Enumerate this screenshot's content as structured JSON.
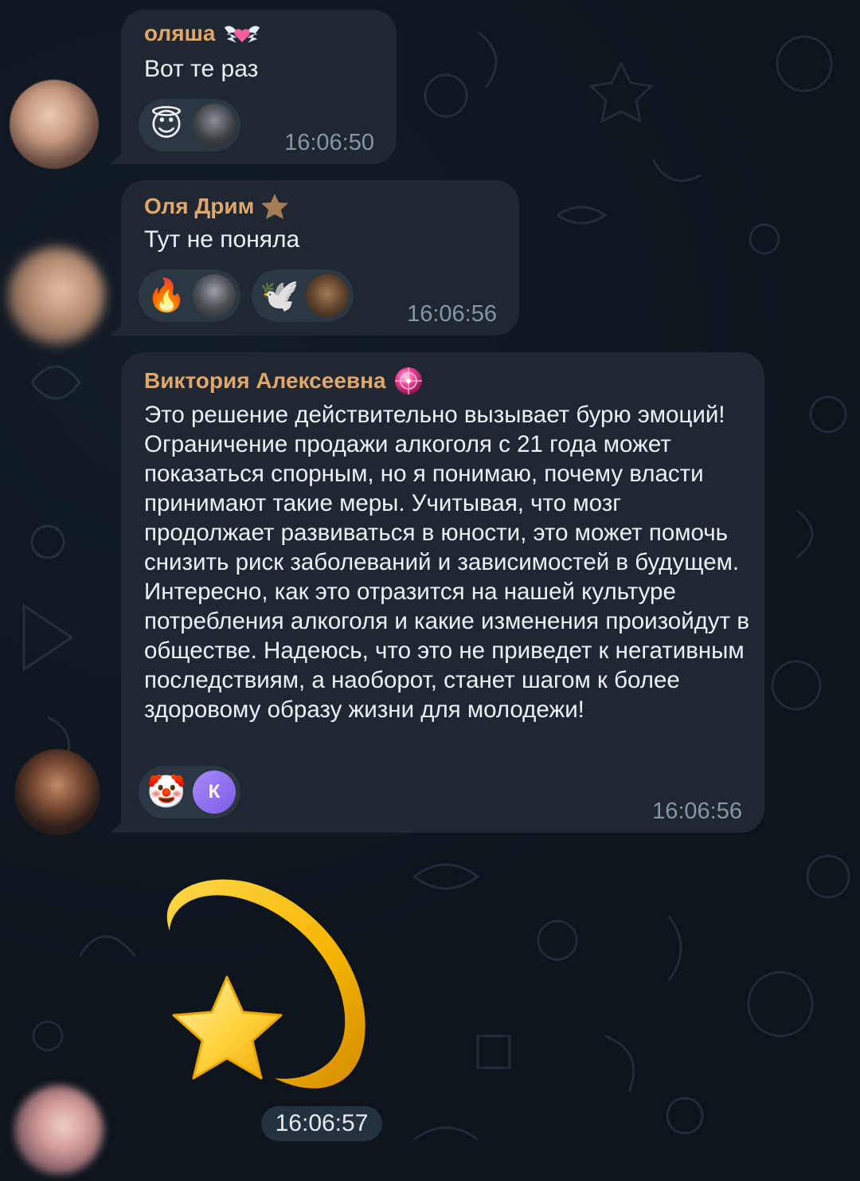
{
  "messages": [
    {
      "sender": "оляша",
      "badge_icon": "winged-heart-icon",
      "text": "Вот те раз",
      "time": "16:06:50",
      "reactions": [
        {
          "emoji": "😇",
          "emoji_name": "smiling-face-with-halo-icon"
        }
      ]
    },
    {
      "sender": "Оля Дрим",
      "badge_icon": "star-icon",
      "text": "Тут не поняла",
      "time": "16:06:56",
      "reactions": [
        {
          "emoji": "🔥",
          "emoji_name": "fire-icon"
        },
        {
          "emoji": "🕊️",
          "emoji_name": "dove-icon"
        }
      ]
    },
    {
      "sender": "Виктория Алексеевна",
      "badge_icon": "pink-orb-icon",
      "text": "Это решение действительно вызывает бурю эмоций! Ограничение продажи алкоголя с 21 года может показаться спорным, но я понимаю, почему власти принимают такие меры. Учитывая, что мозг продолжает развиваться в юности, это может помочь снизить риск заболеваний и зависимостей в будущем. Интересно, как это отразится на нашей культуре потребления алкоголя и какие изменения произойдут в обществе. Надеюсь, что это не приведет к негативным последствиям, а наоборот, станет шагом к более здоровому образу жизни для молодежи!",
      "time": "16:06:56",
      "reactions": [
        {
          "emoji": "🤡",
          "emoji_name": "clown-face-icon",
          "reactor_initial": "К"
        }
      ]
    }
  ],
  "sticker": {
    "icon": "shooting-star-icon",
    "time": "16:06:57"
  },
  "colors": {
    "background": "#0d141c",
    "bubble": "#1e2732",
    "sender_name": "#e0a66a",
    "timestamp": "#8796a6",
    "reaction_pill": "#2b3743"
  }
}
